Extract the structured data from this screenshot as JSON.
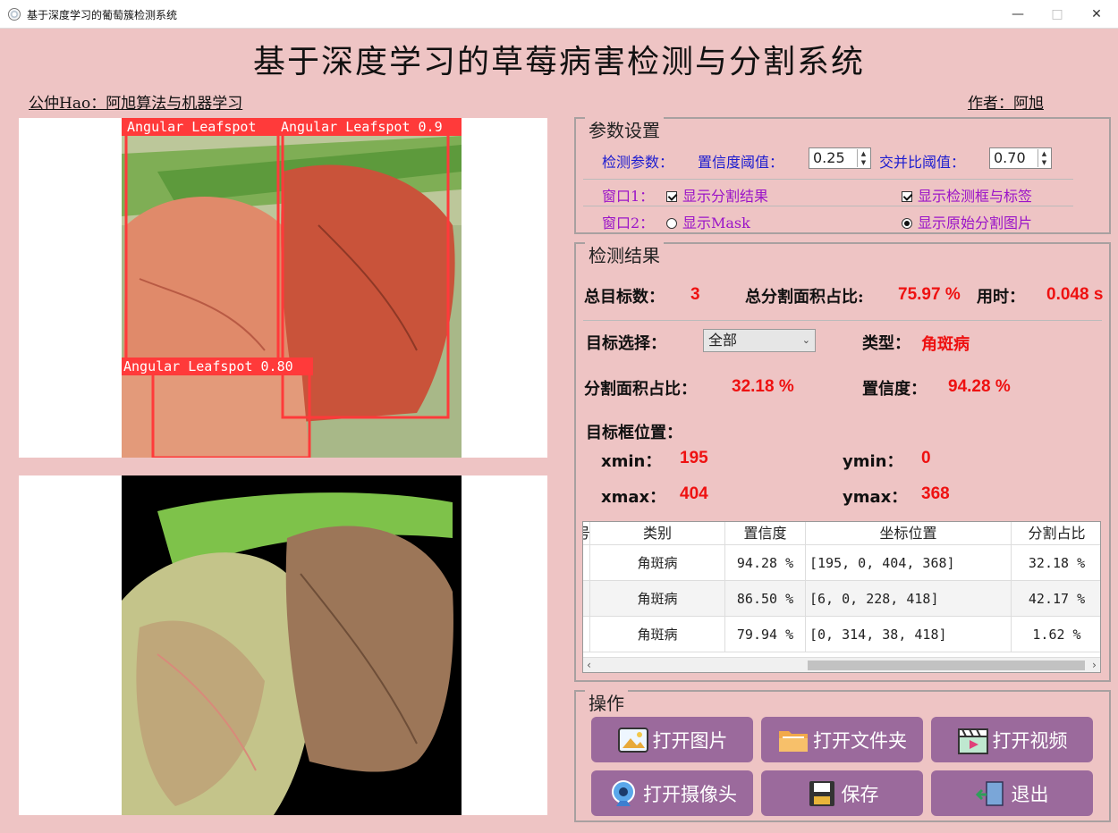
{
  "window": {
    "title": "基于深度学习的葡萄簇检测系统"
  },
  "header": {
    "title": "基于深度学习的草莓病害检测与分割系统",
    "left_link": "公仲Hao：阿旭算法与机器学习",
    "right_link": "作者：阿旭"
  },
  "image1": {
    "detections": [
      {
        "label": "Angular Leafspot"
      },
      {
        "label": "Angular Leafspot 0.9"
      },
      {
        "label": "Angular Leafspot 0.80"
      }
    ]
  },
  "params": {
    "legend": "参数设置",
    "detect_label": "检测参数：",
    "conf_label": "置信度阈值：",
    "conf_value": "0.25",
    "iou_label": "交并比阈值：",
    "iou_value": "0.70",
    "win1_label": "窗口1：",
    "win1_opt1": "显示分割结果",
    "win1_opt2": "显示检测框与标签",
    "win2_label": "窗口2：",
    "win2_opt1": "显示Mask",
    "win2_opt2": "显示原始分割图片"
  },
  "results": {
    "legend": "检测结果",
    "total_label": "总目标数：",
    "total_value": "3",
    "area_label": "总分割面积占比:",
    "area_value": "75.97 %",
    "time_label": "用时：",
    "time_value": "0.048 s",
    "select_label": "目标选择：",
    "select_value": "全部",
    "type_label": "类型：",
    "type_value": "角斑病",
    "seg_label": "分割面积占比：",
    "seg_value": "32.18 %",
    "conf_label": "置信度：",
    "conf_value": "94.28 %",
    "pos_label": "目标框位置：",
    "xmin_label": "xmin：",
    "xmin_value": "195",
    "ymin_label": "ymin：",
    "ymin_value": "0",
    "xmax_label": "xmax：",
    "xmax_value": "404",
    "ymax_label": "ymax：",
    "ymax_value": "368"
  },
  "table": {
    "headers": [
      "号",
      "类别",
      "置信度",
      "坐标位置",
      "分割占比"
    ],
    "rows": [
      [
        "",
        "角斑病",
        "94.28 %",
        "[195, 0, 404, 368]",
        "32.18 %"
      ],
      [
        "",
        "角斑病",
        "86.50 %",
        "[6, 0, 228, 418]",
        "42.17 %"
      ],
      [
        "",
        "角斑病",
        "79.94 %",
        "[0, 314, 38, 418]",
        "1.62 %"
      ]
    ]
  },
  "ops": {
    "legend": "操作",
    "open_image": "打开图片",
    "open_folder": "打开文件夹",
    "open_video": "打开视频",
    "open_camera": "打开摄像头",
    "save": "保存",
    "exit": "退出"
  }
}
